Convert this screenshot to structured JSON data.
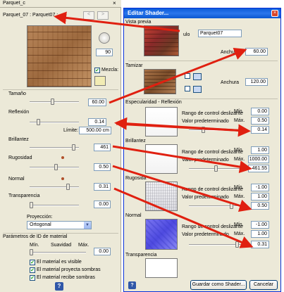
{
  "left": {
    "title": "Parquet_c",
    "material_name": "Parquet_07 : Parquet07 :",
    "rotation_value": "90",
    "mix_label": "Mezcla:",
    "tamano_label": "Tamaño",
    "tamano_value": "60.00",
    "reflexion_label": "Reflexión",
    "reflexion_value": "0.14",
    "limite_label": "Límite:",
    "limite_value": "500.00 cm",
    "brillantez_label": "Brillantez",
    "brillantez_value": "461",
    "rugosidad_label": "Rugosidad",
    "rugosidad_value": "0.50",
    "normal_label": "Normal",
    "normal_value": "0.31",
    "transparencia_label": "Transparencia",
    "transparencia_value": "0.00",
    "proyeccion_label": "Proyección:",
    "proyeccion_value": "Ortogonal",
    "id_section_label": "Parámetros de ID de material",
    "min_label": "Mín.",
    "suavidad_label": "Suavidad",
    "max_label": "Máx.",
    "id_value": "0.00",
    "check1": "El material es visible",
    "check2": "El material proyecta sombras",
    "check3": "El material recibe sombras",
    "help": "?"
  },
  "dialog": {
    "title": "Editar Shader...",
    "vista_previa": "Vista previa",
    "titulo_label": "ulo",
    "titulo_value": "Parquet07",
    "anchura_label": "Anchura",
    "anchura1_value": "60.00",
    "tamizar": "Tamizar",
    "anchura2_value": "120.00",
    "espec_section": "Especularidad - Reflexión",
    "rango": "Rango de control deslizante",
    "valor_pred": "Valor predeterminado",
    "min": "Mín.",
    "max": "Máx.",
    "espec_min": "0.00",
    "espec_max": "0.50",
    "espec_val": "0.14",
    "brillantez": "Brillantez",
    "bri_min": "1.00",
    "bri_max": "1000.00",
    "bri_val": "461.55",
    "rugosidad": "Rugosida",
    "rug_min": "-1.00",
    "rug_max": "1.00",
    "rug_val": "0.50",
    "normal": "Normal",
    "nor_min": "-1.00",
    "nor_max": "1.00",
    "nor_val": "0.31",
    "transparencia": "Transparencia",
    "save_button": "Guardar como Shader...",
    "cancel_button": "Cancelar",
    "help": "?"
  },
  "colors": {
    "arrow": "#e02010",
    "titlebar": "#0a5bd8",
    "panel": "#ece9d8"
  }
}
